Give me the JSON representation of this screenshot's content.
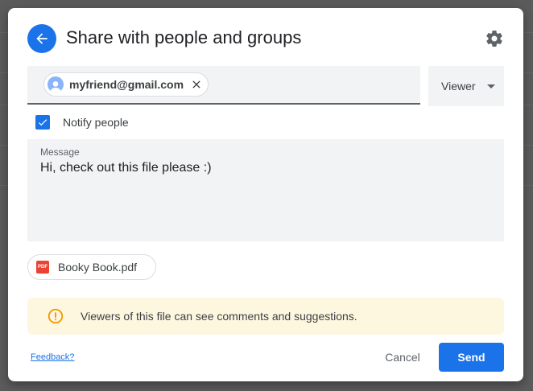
{
  "dialog": {
    "title": "Share with people and groups",
    "back_icon": "arrow-left-icon",
    "settings_icon": "gear-icon"
  },
  "recipients": [
    {
      "email": "myfriend@gmail.com",
      "avatar_icon": "person-avatar-icon",
      "remove_icon": "close-icon"
    }
  ],
  "role": {
    "selected": "Viewer",
    "icon": "caret-down-icon"
  },
  "notify": {
    "label": "Notify people",
    "checked": true
  },
  "message": {
    "label": "Message",
    "value": "Hi, check out this file please :)"
  },
  "attachment": {
    "name": "Booky Book.pdf",
    "icon": "pdf-icon",
    "icon_text": "PDF"
  },
  "info": {
    "text": "Viewers of this file can see comments and suggestions.",
    "icon": "info-icon"
  },
  "footer": {
    "feedback": "Feedback?",
    "cancel": "Cancel",
    "send": "Send"
  },
  "colors": {
    "accent": "#1a73e8",
    "info_bg": "#fef7e0",
    "info_icon": "#f29900",
    "pdf": "#ea4335"
  }
}
